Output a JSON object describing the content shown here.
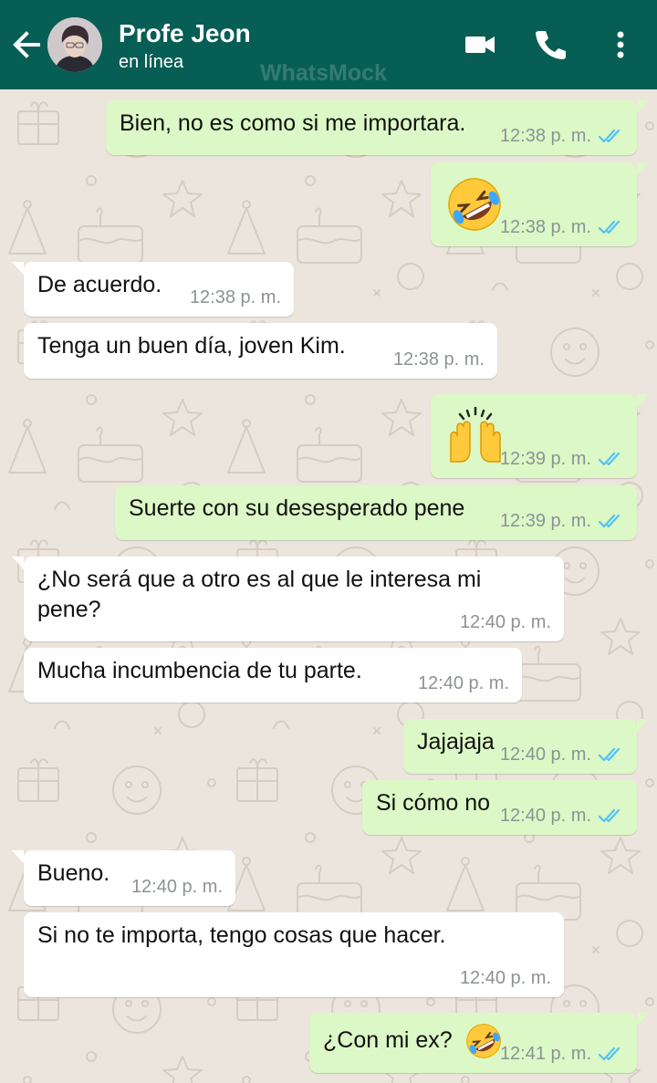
{
  "header": {
    "contact_name": "Profe Jeon",
    "status": "en línea",
    "watermark": "WhatsMock",
    "icons": [
      "back-arrow-icon",
      "avatar-photo",
      "video-call-icon",
      "phone-call-icon",
      "more-options-icon"
    ]
  },
  "colors": {
    "header": "#075e54",
    "chat_background": "#ece5dd",
    "outgoing_bubble": "#dcf8c6",
    "incoming_bubble": "#ffffff",
    "read_ticks": "#4fc3f7",
    "timestamp": "#8d9296"
  },
  "messages": [
    {
      "direction": "outgoing",
      "text": "Bien, no es como si me importara.",
      "time": "12:38 p. m.",
      "status": "read"
    },
    {
      "direction": "outgoing",
      "emoji": "rolling-on-floor-laughing",
      "time": "12:38 p. m.",
      "status": "read"
    },
    {
      "direction": "incoming",
      "text": "De acuerdo.",
      "time": "12:38 p. m."
    },
    {
      "direction": "incoming",
      "text": "Tenga un buen día, joven Kim.",
      "time": "12:38 p. m."
    },
    {
      "direction": "outgoing",
      "emoji": "raising-hands",
      "time": "12:39 p. m.",
      "status": "read"
    },
    {
      "direction": "outgoing",
      "text": "Suerte con su desesperado pene",
      "time": "12:39 p. m.",
      "status": "read"
    },
    {
      "direction": "incoming",
      "text": "¿No será que a otro es al que le interesa mi pene?",
      "time": "12:40 p. m."
    },
    {
      "direction": "incoming",
      "text": "Mucha incumbencia de tu parte.",
      "time": "12:40 p. m."
    },
    {
      "direction": "outgoing",
      "text": "Jajajaja",
      "time": "12:40 p. m.",
      "status": "read"
    },
    {
      "direction": "outgoing",
      "text": "Si cómo no",
      "time": "12:40 p. m.",
      "status": "read"
    },
    {
      "direction": "incoming",
      "text": "Bueno.",
      "time": "12:40 p. m."
    },
    {
      "direction": "incoming",
      "text": "Si no te importa, tengo cosas que hacer.",
      "time": "12:40 p. m."
    },
    {
      "direction": "outgoing",
      "text": "¿Con mi ex?",
      "emoji": "rolling-on-floor-laughing",
      "time": "12:41 p. m.",
      "status": "read"
    }
  ]
}
